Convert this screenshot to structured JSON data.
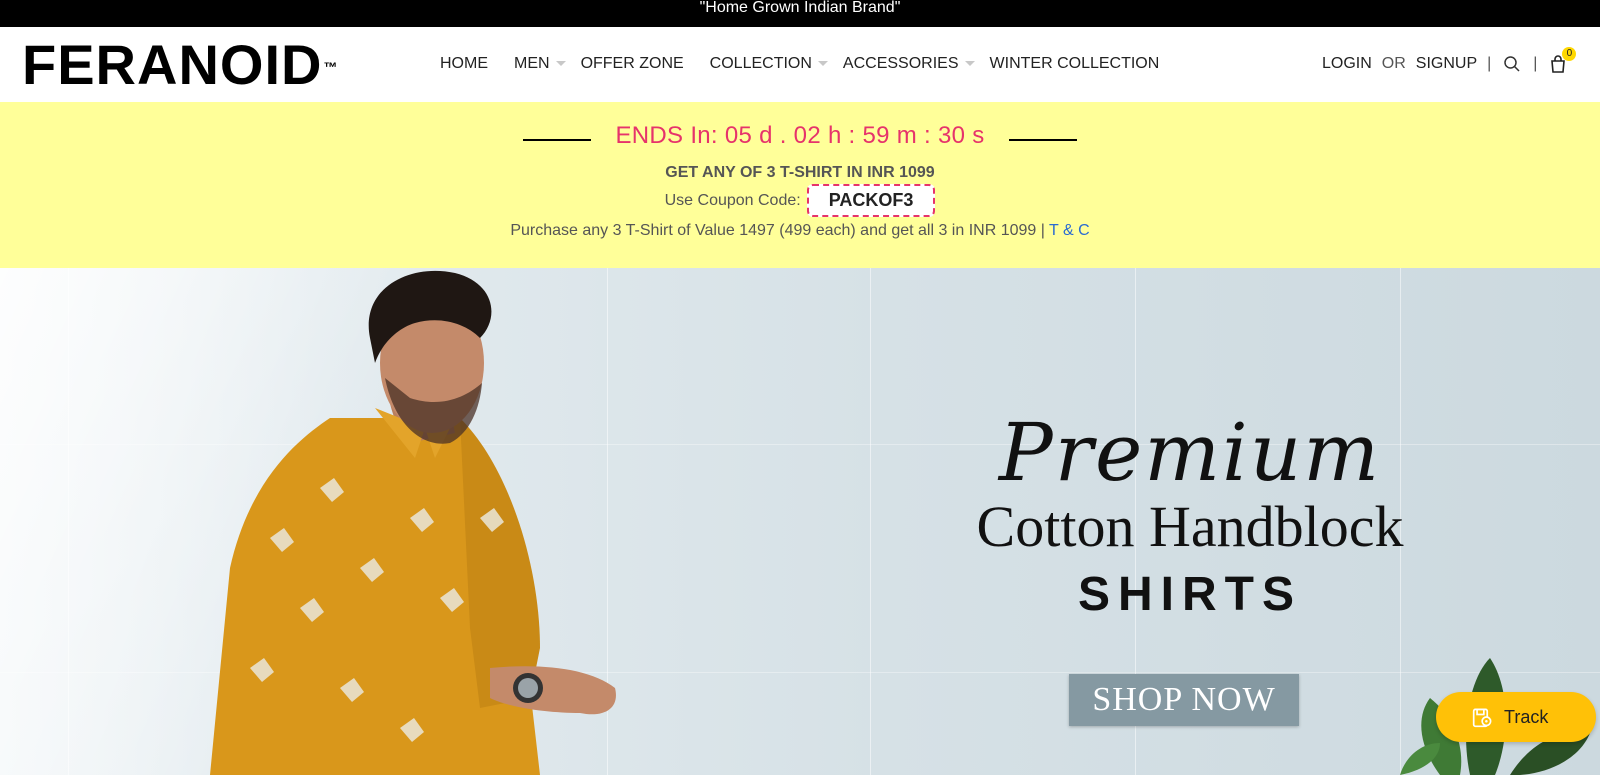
{
  "topbar": {
    "text": "\"Home Grown Indian Brand\""
  },
  "header": {
    "logo": "FERANOID",
    "logo_mark": "™",
    "nav": [
      {
        "label": "HOME",
        "dropdown": false
      },
      {
        "label": "MEN",
        "dropdown": true
      },
      {
        "label": "OFFER ZONE",
        "dropdown": false
      },
      {
        "label": "COLLECTION",
        "dropdown": true
      },
      {
        "label": "ACCESSORIES",
        "dropdown": true
      },
      {
        "label": "WINTER COLLECTION",
        "dropdown": false
      }
    ],
    "login": "LOGIN",
    "or": "OR",
    "signup": "SIGNUP",
    "separator": "|",
    "cart_count": "0"
  },
  "offer": {
    "timer": "ENDS In: 05  d  . 02  h  : 59 m : 30  s",
    "headline": "GET ANY OF 3 T-SHIRT IN INR 1099",
    "coupon_label": "Use Coupon Code:",
    "coupon_code": "PACKOF3",
    "terms_text": "Purchase any 3 T-Shirt of Value 1497 (499 each) and get all 3 in INR 1099 |",
    "terms_link": "T & C"
  },
  "hero": {
    "script": "Premium",
    "subtitle": "Cotton Handblock",
    "big": "SHIRTS",
    "cta": "SHOP NOW"
  },
  "track_widget": {
    "label": "Track"
  },
  "colors": {
    "topbar_bg": "#000000",
    "offer_bg": "#ffff99",
    "timer": "#e6336b",
    "coupon_border": "#e6336b",
    "link": "#2a6bd1",
    "cta_bg": "#8599a2",
    "track_bg": "#ffc107",
    "badge": "#ffd800"
  },
  "icons": [
    "search-icon",
    "cart-icon",
    "chevron-down-icon",
    "track-icon"
  ]
}
